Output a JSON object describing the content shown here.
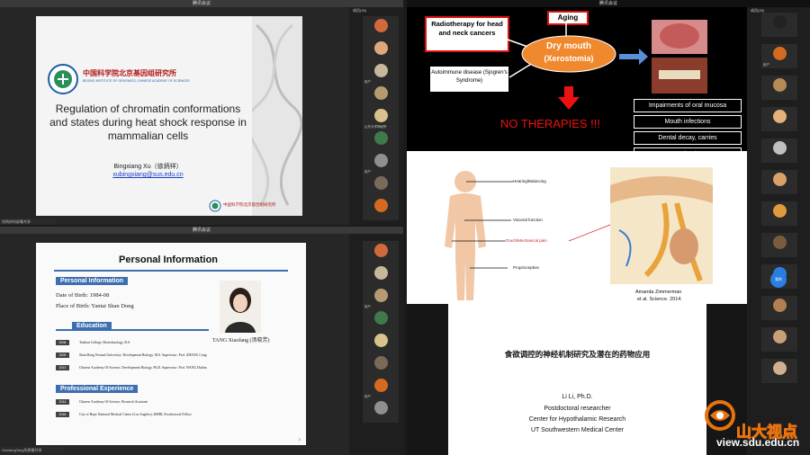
{
  "top_left_window": {
    "title": "腾讯会议",
    "status": "徐炳祥的屏幕共享",
    "slide": {
      "institute_cn": "中国科学院北京基因组研究所",
      "institute_en": "BEIJING INSTITUTE OF GENOMICS, CHINESE ACADEMY OF SCIENCES",
      "title": "Regulation of chromatin conformations and states during heat shock response in mammalian cells",
      "author": "Bingxiang Xu（徐炳祥）",
      "email": "xubingxiang@sus.edu.cn",
      "footer_logo_cn": "中国科学院北京基因组研究所"
    },
    "participants": [
      {
        "name": "",
        "color": "#d2693a"
      },
      {
        "name": "",
        "color": "#e0a87a"
      },
      {
        "name": "用户",
        "color": "#c7b79b"
      },
      {
        "name": "",
        "color": "#b79a72"
      },
      {
        "name": "山东大学神经所",
        "color": "#d9c28c"
      },
      {
        "name": "",
        "color": "#3f7a4c"
      },
      {
        "name": "用户",
        "color": "#8f8f8f"
      },
      {
        "name": "",
        "color": "#7a6a5a"
      },
      {
        "name": "",
        "color": "#d46a1f"
      }
    ],
    "side_header": "成员(30)"
  },
  "bottom_left_window": {
    "title": "腾讯会议",
    "status": "XiaofangTang的屏幕共享",
    "slide": {
      "heading": "Personal Information",
      "sec_personal": "Personal Information",
      "dob": "Date of Birth: 1984-08",
      "pob": "Place of Birth: Yantai Shan Dong",
      "sec_education": "Education",
      "photo_caption": "TANG Xiaofang (汤晓芳)",
      "education": [
        {
          "year": "2006",
          "text": "Taishan College, Biotechnology, B.S."
        },
        {
          "year": "2009",
          "text": "Shan Dong Normal University: Development Biology. M.S. Supervisor: Prof. ZHANG Cong"
        },
        {
          "year": "2013",
          "text": "Chinese Academy Of Science, Development Biology. Ph.D. Supervisor: Prof. WANG Haibin"
        }
      ],
      "sec_experience": "Professional Experience",
      "experience": [
        {
          "year": "2014",
          "text": "Chinese Academy Of Science, Research Assistant"
        },
        {
          "year": "2018",
          "text": "City of Hope National Medical Center (Los Angeles), DMRI, Postdoctoral Fellow"
        }
      ],
      "page_num": "2"
    },
    "participants": [
      {
        "name": "",
        "color": "#d2693a"
      },
      {
        "name": "",
        "color": "#c7b79b"
      },
      {
        "name": "用户",
        "color": "#b79a72"
      },
      {
        "name": "",
        "color": "#3f7a4c"
      },
      {
        "name": "",
        "color": "#d9c28c"
      },
      {
        "name": "",
        "color": "#7a6a5a"
      },
      {
        "name": "用户",
        "color": "#d46a1f"
      },
      {
        "name": "",
        "color": "#8f8f8f"
      }
    ]
  },
  "right_window": {
    "title": "腾讯会议",
    "slide_top": {
      "box_radiotherapy": "Radiotherapy for head and neck cancers",
      "box_aging": "Aging",
      "box_autoimmune": "Autoimmune disease (Sjogren's Syndrome)",
      "ellipse_line1": "Dry mouth",
      "ellipse_line2": "(Xerostomia)",
      "no_therapies": "NO THERAPIES !!!",
      "list": [
        "Impairments of oral mucosa",
        "Mouth infections",
        "Dental decay, carries",
        "Dysphagia..."
      ]
    },
    "slide_mid": {
      "labels": [
        "Hearing/Balancing",
        "Visceral function",
        "Touch/Mechanical pain",
        "Proprioception"
      ],
      "citation_line1": "Amanda Zimmerman",
      "citation_line2": "et al. Science. 2014."
    },
    "slide_bottom": {
      "title_cn": "食欲调控的神经机制研究及潜在的药物应用",
      "speaker": "Li Li, Ph.D.",
      "role": "Postdoctoral researcher",
      "center": "Center for Hypothalamic Research",
      "university": "UT Southwestern Medical Center"
    },
    "side_header": "成员(28)",
    "self_button": "我的",
    "participants": [
      {
        "name": "",
        "color": "#222222"
      },
      {
        "name": "用户",
        "color": "#d46a1f"
      },
      {
        "name": "",
        "color": "#b58a56"
      },
      {
        "name": "",
        "color": "#e6b07a"
      },
      {
        "name": "",
        "color": "#c0c0c0"
      },
      {
        "name": "",
        "color": "#d9a06a"
      },
      {
        "name": "",
        "color": "#e09a40"
      },
      {
        "name": "",
        "color": "#7a5c3c"
      },
      {
        "name": "",
        "color": "#2a7de1"
      },
      {
        "name": "",
        "color": "#b08050"
      },
      {
        "name": "",
        "color": "#c8a078"
      },
      {
        "name": "",
        "color": "#d0b090"
      }
    ]
  },
  "watermark": {
    "brand": "山大视点",
    "url": "view.sdu.edu.cn"
  }
}
